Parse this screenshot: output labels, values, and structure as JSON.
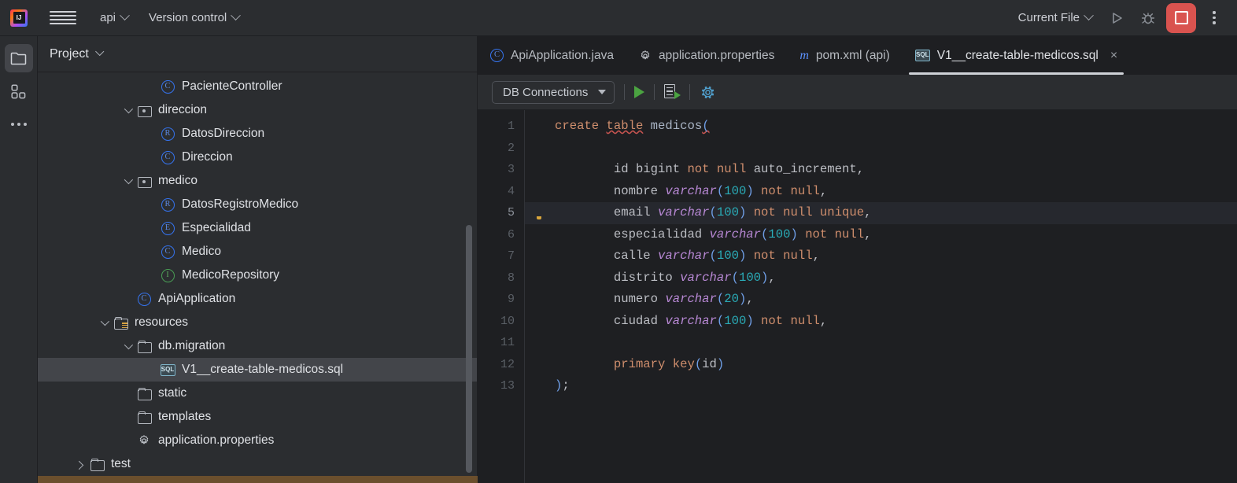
{
  "topbar": {
    "logo_name": "intellij-idea-logo",
    "menu_icon": "hamburger-menu-icon",
    "project_name": "api",
    "vcs_label": "Version control",
    "run_config": "Current File",
    "run_icon": "run-icon",
    "debug_icon": "debug-icon",
    "stop_icon": "stop-icon",
    "more_icon": "more-vertical-icon",
    "stop_color": "#d9534f"
  },
  "rail": {
    "items": [
      {
        "name": "project-tool-window-icon",
        "active": true
      },
      {
        "name": "plugins-icon",
        "active": false
      },
      {
        "name": "more-tool-windows-icon",
        "active": false
      }
    ]
  },
  "project_panel": {
    "title": "Project",
    "tree": [
      {
        "label": "PacienteController",
        "icon": "class-icon",
        "badge": "C",
        "indent": 5,
        "arrow": "none",
        "selected": false
      },
      {
        "label": "direccion",
        "icon": "package-icon",
        "badge": null,
        "indent": 4,
        "arrow": "down",
        "selected": false
      },
      {
        "label": "DatosDireccion",
        "icon": "record-icon",
        "badge": "R",
        "indent": 5,
        "arrow": "none",
        "selected": false
      },
      {
        "label": "Direccion",
        "icon": "class-icon",
        "badge": "C",
        "indent": 5,
        "arrow": "none",
        "selected": false
      },
      {
        "label": "medico",
        "icon": "package-icon",
        "badge": null,
        "indent": 4,
        "arrow": "down",
        "selected": false
      },
      {
        "label": "DatosRegistroMedico",
        "icon": "record-icon",
        "badge": "R",
        "indent": 5,
        "arrow": "none",
        "selected": false
      },
      {
        "label": "Especialidad",
        "icon": "enum-icon",
        "badge": "E",
        "indent": 5,
        "arrow": "none",
        "selected": false
      },
      {
        "label": "Medico",
        "icon": "class-icon",
        "badge": "C",
        "indent": 5,
        "arrow": "none",
        "selected": false
      },
      {
        "label": "MedicoRepository",
        "icon": "interface-icon",
        "badge": "I",
        "indent": 5,
        "arrow": "none",
        "selected": false
      },
      {
        "label": "ApiApplication",
        "icon": "class-icon",
        "badge": "C",
        "indent": 4,
        "arrow": "none",
        "selected": false
      },
      {
        "label": "resources",
        "icon": "resources-folder-icon",
        "badge": null,
        "indent": 3,
        "arrow": "down",
        "selected": false
      },
      {
        "label": "db.migration",
        "icon": "folder-icon",
        "badge": null,
        "indent": 4,
        "arrow": "down",
        "selected": false
      },
      {
        "label": "V1__create-table-medicos.sql",
        "icon": "sql-file-icon",
        "badge": null,
        "indent": 5,
        "arrow": "none",
        "selected": true
      },
      {
        "label": "static",
        "icon": "folder-icon",
        "badge": null,
        "indent": 4,
        "arrow": "none",
        "selected": false
      },
      {
        "label": "templates",
        "icon": "folder-icon",
        "badge": null,
        "indent": 4,
        "arrow": "none",
        "selected": false
      },
      {
        "label": "application.properties",
        "icon": "properties-icon",
        "badge": null,
        "indent": 4,
        "arrow": "none",
        "selected": false
      },
      {
        "label": "test",
        "icon": "folder-icon",
        "badge": null,
        "indent": 2,
        "arrow": "right",
        "selected": false
      }
    ],
    "scrollbar_horizontal_color": "#6b4f2d"
  },
  "editor": {
    "tabs": [
      {
        "label": "ApiApplication.java",
        "icon": "java-class-icon",
        "active": false,
        "closable": false
      },
      {
        "label": "application.properties",
        "icon": "properties-icon",
        "active": false,
        "closable": false
      },
      {
        "label": "pom.xml (api)",
        "icon": "maven-icon",
        "active": false,
        "closable": false
      },
      {
        "label": "V1__create-table-medicos.sql",
        "icon": "sql-file-icon",
        "active": true,
        "closable": true
      }
    ],
    "close_glyph": "×",
    "toolbar": {
      "db_connections_label": "DB Connections",
      "run_icon": "run-query-icon",
      "run_script_icon": "run-script-icon",
      "settings_icon": "gear-icon"
    },
    "gutter_bulb_line": 5,
    "current_line": 5,
    "lines": [
      {
        "n": 1,
        "tokens": [
          {
            "t": "create",
            "c": "kw"
          },
          {
            "t": " ",
            "c": "id"
          },
          {
            "t": "table",
            "c": "kw err"
          },
          {
            "t": " ",
            "c": "id"
          },
          {
            "t": "medicos",
            "c": "tblname"
          },
          {
            "t": "(",
            "c": "par err"
          }
        ]
      },
      {
        "n": 2,
        "tokens": []
      },
      {
        "n": 3,
        "tokens": [
          {
            "t": "        id",
            "c": "id"
          },
          {
            "t": " ",
            "c": "id"
          },
          {
            "t": "bigint",
            "c": "id"
          },
          {
            "t": " ",
            "c": "id"
          },
          {
            "t": "not null",
            "c": "kw"
          },
          {
            "t": " ",
            "c": "id"
          },
          {
            "t": "auto_increment",
            "c": "id"
          },
          {
            "t": ",",
            "c": "id"
          }
        ]
      },
      {
        "n": 4,
        "tokens": [
          {
            "t": "        nombre ",
            "c": "id"
          },
          {
            "t": "varchar",
            "c": "typ"
          },
          {
            "t": "(",
            "c": "par"
          },
          {
            "t": "100",
            "c": "num"
          },
          {
            "t": ")",
            "c": "par"
          },
          {
            "t": " ",
            "c": "id"
          },
          {
            "t": "not null",
            "c": "kw"
          },
          {
            "t": ",",
            "c": "id"
          }
        ]
      },
      {
        "n": 5,
        "tokens": [
          {
            "t": "        email ",
            "c": "id"
          },
          {
            "t": "varchar",
            "c": "typ"
          },
          {
            "t": "(",
            "c": "par"
          },
          {
            "t": "100",
            "c": "num"
          },
          {
            "t": ")",
            "c": "par"
          },
          {
            "t": " ",
            "c": "id"
          },
          {
            "t": "not null unique",
            "c": "kw"
          },
          {
            "t": ",",
            "c": "id"
          }
        ]
      },
      {
        "n": 6,
        "tokens": [
          {
            "t": "        especialidad ",
            "c": "id"
          },
          {
            "t": "varchar",
            "c": "typ"
          },
          {
            "t": "(",
            "c": "par"
          },
          {
            "t": "100",
            "c": "num"
          },
          {
            "t": ")",
            "c": "par"
          },
          {
            "t": " ",
            "c": "id"
          },
          {
            "t": "not null",
            "c": "kw"
          },
          {
            "t": ",",
            "c": "id"
          }
        ]
      },
      {
        "n": 7,
        "tokens": [
          {
            "t": "        calle ",
            "c": "id"
          },
          {
            "t": "varchar",
            "c": "typ"
          },
          {
            "t": "(",
            "c": "par"
          },
          {
            "t": "100",
            "c": "num"
          },
          {
            "t": ")",
            "c": "par"
          },
          {
            "t": " ",
            "c": "id"
          },
          {
            "t": "not null",
            "c": "kw"
          },
          {
            "t": ",",
            "c": "id"
          }
        ]
      },
      {
        "n": 8,
        "tokens": [
          {
            "t": "        distrito ",
            "c": "id"
          },
          {
            "t": "varchar",
            "c": "typ"
          },
          {
            "t": "(",
            "c": "par"
          },
          {
            "t": "100",
            "c": "num"
          },
          {
            "t": ")",
            "c": "par"
          },
          {
            "t": ",",
            "c": "id"
          }
        ]
      },
      {
        "n": 9,
        "tokens": [
          {
            "t": "        numero ",
            "c": "id"
          },
          {
            "t": "varchar",
            "c": "typ"
          },
          {
            "t": "(",
            "c": "par"
          },
          {
            "t": "20",
            "c": "num"
          },
          {
            "t": ")",
            "c": "par"
          },
          {
            "t": ",",
            "c": "id"
          }
        ]
      },
      {
        "n": 10,
        "tokens": [
          {
            "t": "        ciudad ",
            "c": "id"
          },
          {
            "t": "varchar",
            "c": "typ"
          },
          {
            "t": "(",
            "c": "par"
          },
          {
            "t": "100",
            "c": "num"
          },
          {
            "t": ")",
            "c": "par"
          },
          {
            "t": " ",
            "c": "id"
          },
          {
            "t": "not null",
            "c": "kw"
          },
          {
            "t": ",",
            "c": "id"
          }
        ]
      },
      {
        "n": 11,
        "tokens": []
      },
      {
        "n": 12,
        "tokens": [
          {
            "t": "        ",
            "c": "id"
          },
          {
            "t": "primary key",
            "c": "kw"
          },
          {
            "t": "(",
            "c": "par"
          },
          {
            "t": "id",
            "c": "id"
          },
          {
            "t": ")",
            "c": "par"
          }
        ]
      },
      {
        "n": 13,
        "tokens": [
          {
            "t": ")",
            "c": "par"
          },
          {
            "t": ";",
            "c": "id"
          }
        ]
      }
    ]
  }
}
